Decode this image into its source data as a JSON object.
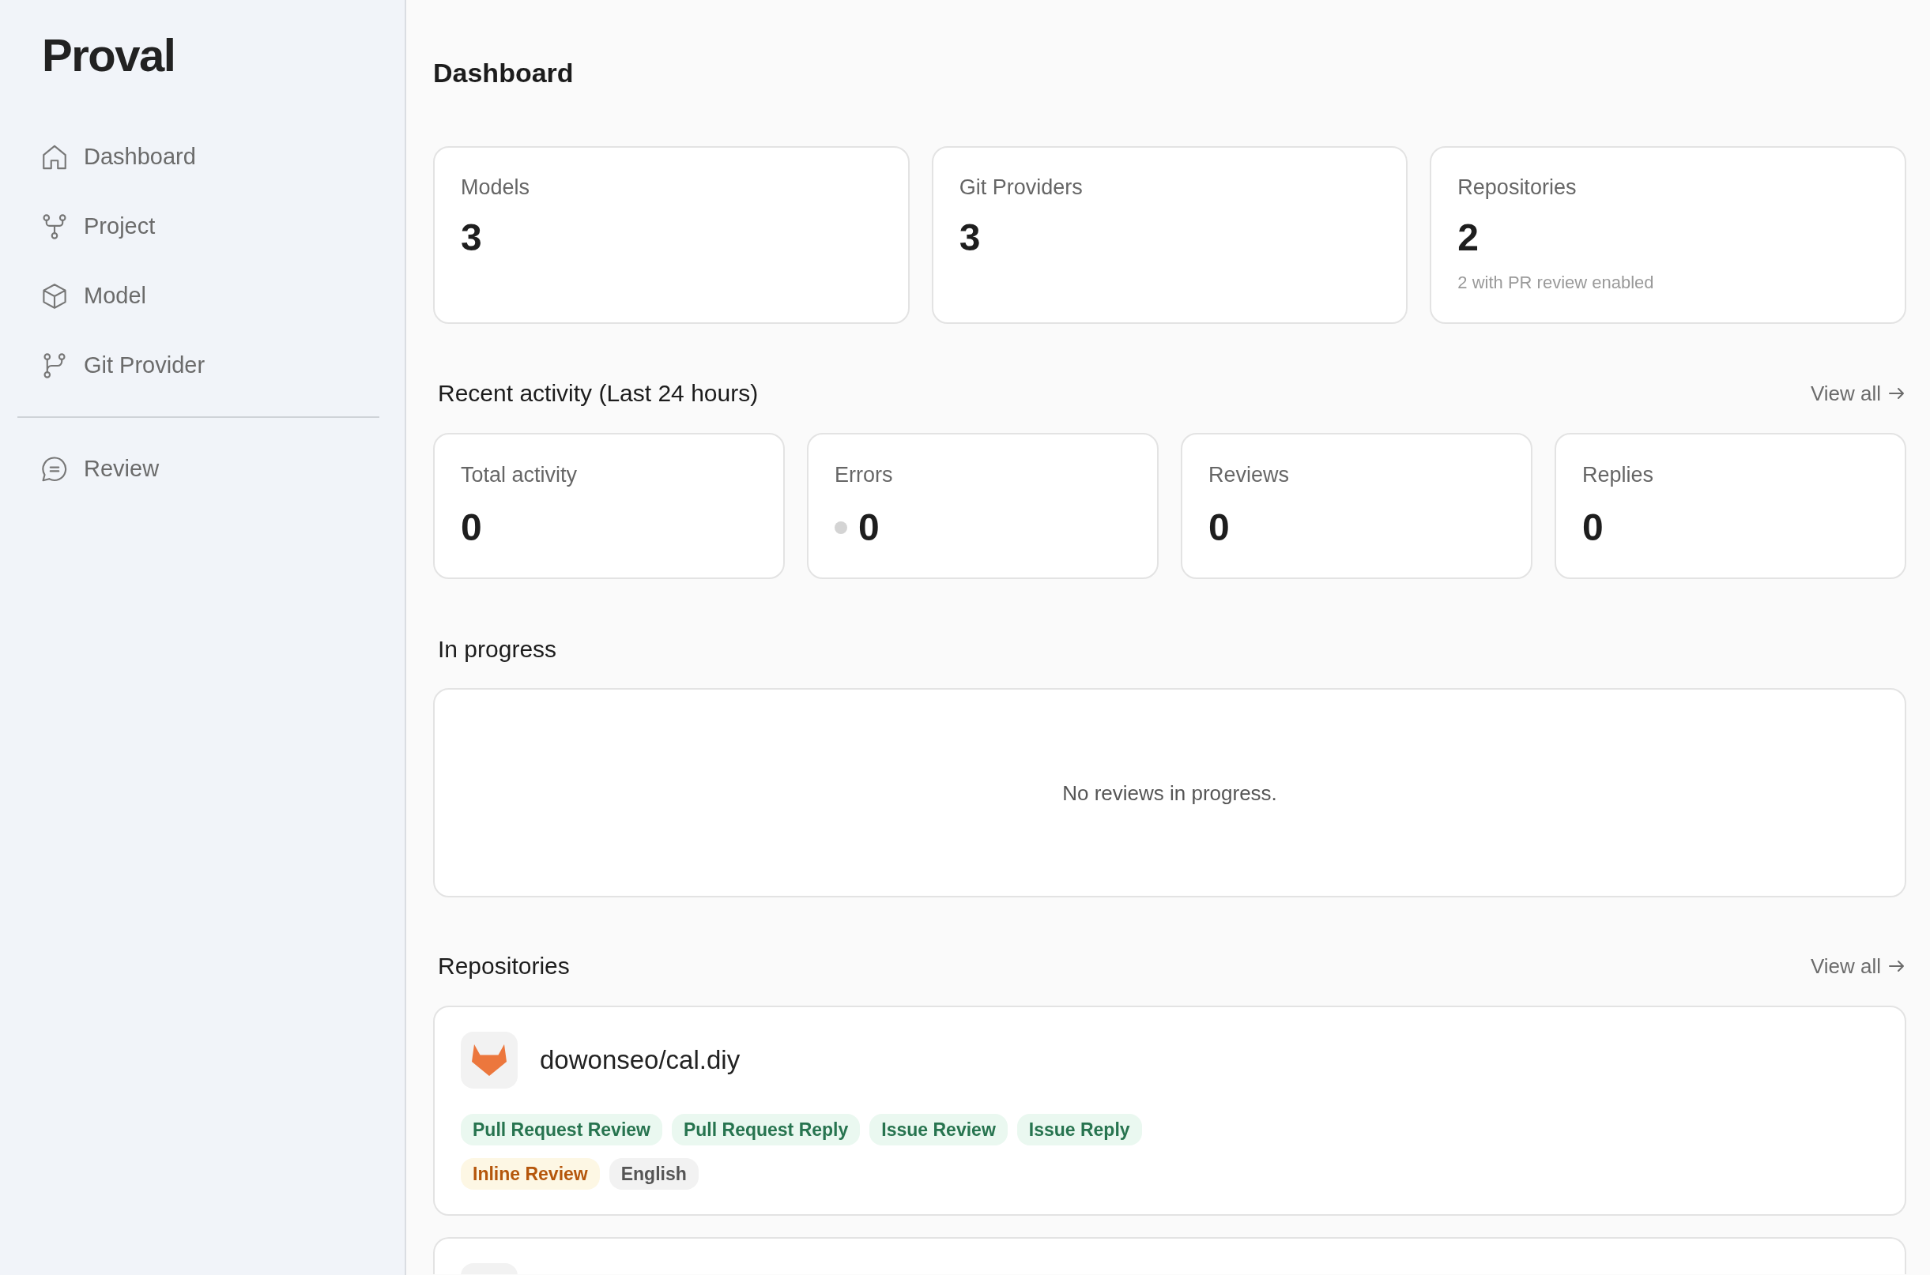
{
  "sidebar": {
    "logo": "Proval",
    "nav_groups": [
      {
        "items": [
          {
            "label": "Dashboard"
          },
          {
            "label": "Project"
          },
          {
            "label": "Model"
          },
          {
            "label": "Git Provider"
          }
        ]
      },
      {
        "items": [
          {
            "label": "Review"
          }
        ]
      }
    ]
  },
  "main": {
    "title": "Dashboard",
    "summary_cards": [
      {
        "label": "Models",
        "value": "3"
      },
      {
        "label": "Git Providers",
        "value": "3"
      },
      {
        "label": "Repositories",
        "value": "2",
        "note": "2 with PR review enabled"
      }
    ],
    "recent_activity": {
      "title": "Recent activity (Last 24 hours)",
      "link": "View all",
      "cards": [
        {
          "label": "Total activity",
          "value": "0"
        },
        {
          "label": "Errors",
          "value": "0",
          "color": "#d4d4d4"
        },
        {
          "label": "Reviews",
          "value": "0"
        },
        {
          "label": "Replies",
          "value": "0"
        }
      ]
    },
    "in_progress": {
      "title": "In progress",
      "empty_message": "No reviews in progress."
    },
    "repositories": {
      "title": "Repositories",
      "link": "View all",
      "items": [
        {
          "name": "dowonseo/cal.diy",
          "tag_rows": [
            {
              "tags": [
                {
                  "label": "Pull Request Review",
                  "kind": "feature"
                },
                {
                  "label": "Pull Request Reply",
                  "kind": "feature"
                },
                {
                  "label": "Issue Review",
                  "kind": "feature"
                },
                {
                  "label": "Issue Reply",
                  "kind": "feature"
                }
              ]
            },
            {
              "tags": [
                {
                  "label": "Inline Review",
                  "kind": "option"
                },
                {
                  "label": "English",
                  "kind": "language"
                }
              ]
            }
          ]
        }
      ],
      "next_item_cut_off": true
    }
  }
}
